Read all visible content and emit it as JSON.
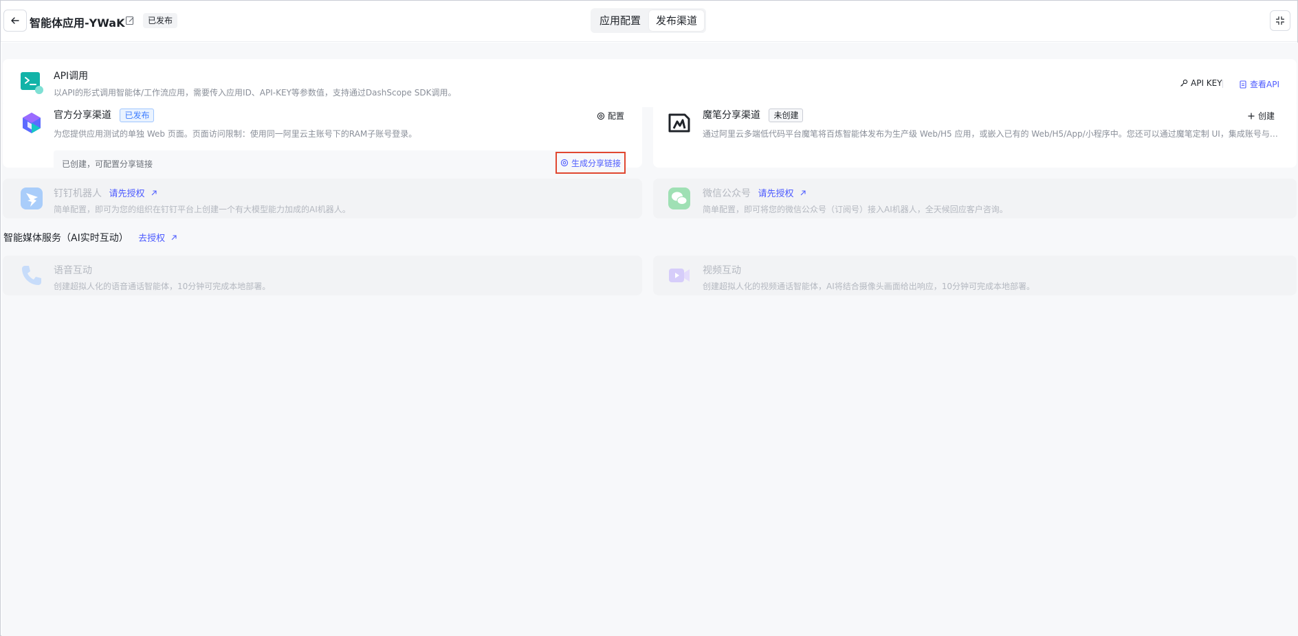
{
  "header": {
    "app_title": "智能体应用-YWaK",
    "status": "已发布",
    "tabs": [
      {
        "label": "应用配置"
      },
      {
        "label": "发布渠道"
      }
    ]
  },
  "api_card": {
    "title": "API调用",
    "desc": "以API的形式调用智能体/工作流应用，需要传入应用ID、API-KEY等参数值，支持通过DashScope SDK调用。",
    "api_key_label": "API KEY",
    "view_api_label": "查看API"
  },
  "official_share": {
    "title": "官方分享渠道",
    "status": "已发布",
    "config_label": "配置",
    "desc": "为您提供应用测试的单独 Web 页面。页面访问限制：使用同一阿里云主账号下的RAM子账号登录。",
    "sub_text": "已创建，可配置分享链接",
    "generate_link_label": "生成分享链接"
  },
  "mobi_share": {
    "title": "魔笔分享渠道",
    "status": "未创建",
    "create_label": "创建",
    "desc": "通过阿里云多端低代码平台魔笔将百炼智能体发布为生产级 Web/H5 应用，或嵌入已有的 Web/H5/App/小程序中。您还可以通过魔笔定制 UI，集成账号与业..."
  },
  "dingtalk": {
    "title": "钉钉机器人",
    "auth_label": "请先授权",
    "desc": "简单配置，即可为您的组织在钉钉平台上创建一个有大模型能力加成的AI机器人。"
  },
  "wechat": {
    "title": "微信公众号",
    "auth_label": "请先授权",
    "desc": "简单配置，即可将您的微信公众号（订阅号）接入AI机器人，全天候回应客户咨询。"
  },
  "media_section": {
    "title": "智能媒体服务（AI实时互动）",
    "auth_label": "去授权"
  },
  "voice": {
    "title": "语音互动",
    "desc": "创建超拟人化的语音通话智能体，10分钟可完成本地部署。"
  },
  "video": {
    "title": "视频互动",
    "desc": "创建超拟人化的视频通话智能体，AI将结合摄像头画面给出响应，10分钟可完成本地部署。"
  },
  "colors": {
    "accent": "#4d5bff",
    "highlight_border": "#e0462f",
    "teal": "#12b3a8"
  }
}
